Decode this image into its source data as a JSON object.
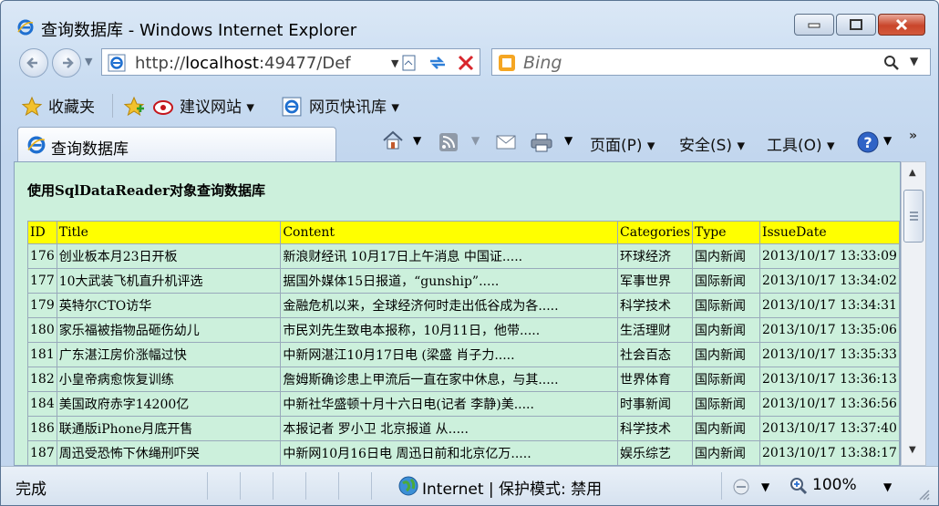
{
  "window": {
    "title": "查询数据库 - Windows Internet Explorer"
  },
  "address": {
    "url_prefix": "http://",
    "url_host": "localhost",
    "url_rest": ":49477/Def"
  },
  "search": {
    "placeholder": "Bing"
  },
  "favorites": {
    "label": "收藏夹",
    "items": [
      "建议网站 ▾",
      "网页快讯库 ▾"
    ]
  },
  "tab": {
    "title": "查询数据库"
  },
  "commandbar": {
    "page": "页面(P) ▾",
    "safety": "安全(S) ▾",
    "tools": "工具(O) ▾"
  },
  "page": {
    "heading": "使用SqlDataReader对象查询数据库",
    "columns": [
      "ID",
      "Title",
      "Content",
      "Categories",
      "Type",
      "IssueDate"
    ],
    "rows": [
      [
        "176",
        "创业板本月23日开板",
        "新浪财经讯  10月17日上午消息  中国证.....",
        "环球经济",
        "国内新闻",
        "2013/10/17 13:33:09"
      ],
      [
        "177",
        "10大武装飞机直升机评选",
        "据国外媒体15日报道，“gunship”.....",
        "军事世界",
        "国际新闻",
        "2013/10/17 13:34:02"
      ],
      [
        "179",
        "英特尔CTO访华",
        "金融危机以来，全球经济何时走出低谷成为各.....",
        "科学技术",
        "国际新闻",
        "2013/10/17 13:34:31"
      ],
      [
        "180",
        "家乐福被指物品砸伤幼儿",
        "市民刘先生致电本报称，10月11日，他带.....",
        "生活理财",
        "国内新闻",
        "2013/10/17 13:35:06"
      ],
      [
        "181",
        "广东湛江房价涨幅过快",
        "中新网湛江10月17日电  (梁盛  肖子力.....",
        "社会百态",
        "国内新闻",
        "2013/10/17 13:35:33"
      ],
      [
        "182",
        "小皇帝病愈恢复训练",
        "詹姆斯确诊患上甲流后一直在家中休息，与其.....",
        "世界体育",
        "国际新闻",
        "2013/10/17 13:36:13"
      ],
      [
        "184",
        "美国政府赤字14200亿",
        "中新社华盛顿十月十六日电(记者  李静)美.....",
        "时事新闻",
        "国际新闻",
        "2013/10/17 13:36:56"
      ],
      [
        "186",
        "联通版iPhone月底开售",
        "本报记者  罗小卫  北京报道         从.....",
        "科学技术",
        "国内新闻",
        "2013/10/17 13:37:40"
      ],
      [
        "187",
        "周迅受恐怖下休绳刑吓哭",
        "中新网10月16日电  周迅日前和北京亿万.....",
        "娱乐综艺",
        "国内新闻",
        "2013/10/17 13:38:17"
      ]
    ]
  },
  "statusbar": {
    "text": "完成",
    "zone": "Internet | 保护模式: 禁用",
    "zoom": "100%"
  }
}
